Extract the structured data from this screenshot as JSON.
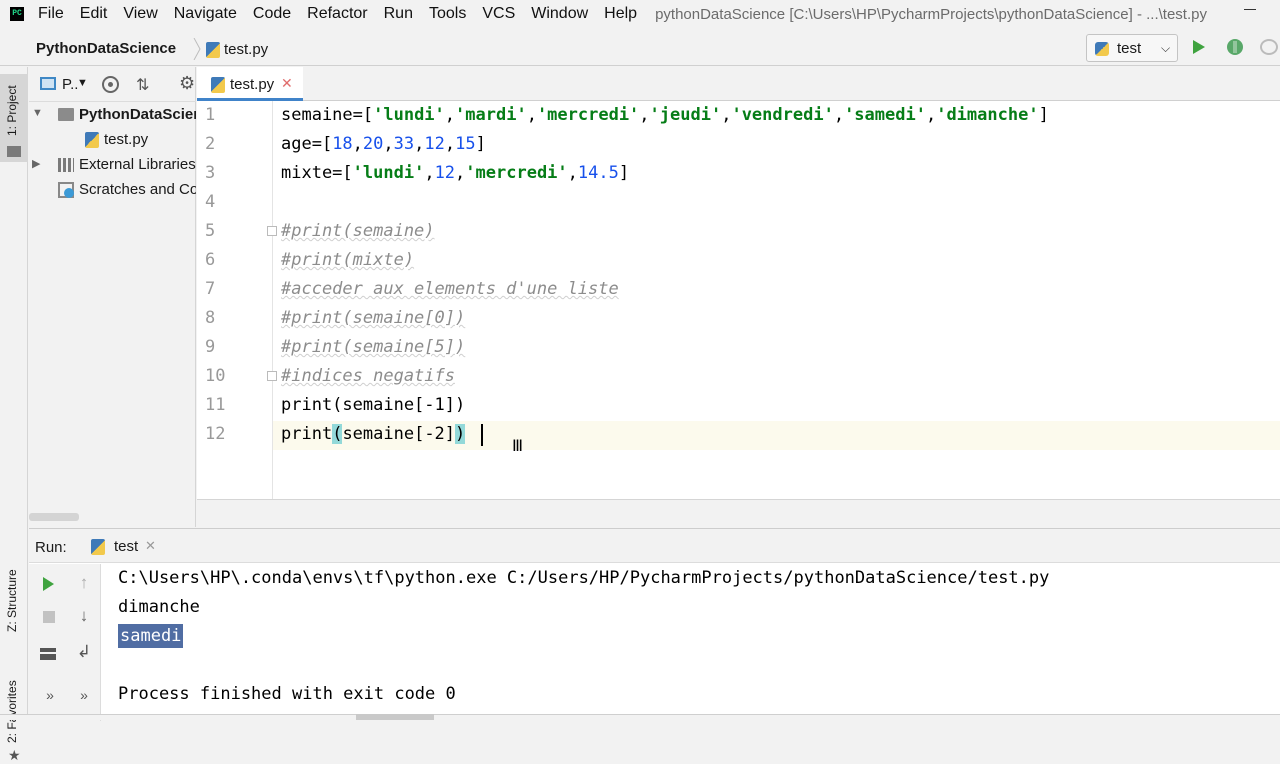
{
  "app": {
    "logo_text": "PC"
  },
  "menu": {
    "items": [
      "File",
      "Edit",
      "View",
      "Navigate",
      "Code",
      "Refactor",
      "Run",
      "Tools",
      "VCS",
      "Window",
      "Help"
    ],
    "window_title": "pythonDataScience [C:\\Users\\HP\\PycharmProjects\\pythonDataScience] - ...\\test.py"
  },
  "navbar": {
    "project": "PythonDataScience",
    "file": "test.py",
    "run_config": "test"
  },
  "left_stripe": {
    "project_label": "1: Project",
    "structure_label": "Z: Structure",
    "favorites_label": "2: Favorites"
  },
  "project_panel": {
    "view_label": "P..",
    "tree": {
      "root": "PythonDataScience",
      "file": "test.py",
      "external": "External Libraries",
      "scratches": "Scratches and Consoles"
    }
  },
  "editor": {
    "tab_label": "test.py",
    "line_numbers": [
      "1",
      "2",
      "3",
      "4",
      "5",
      "6",
      "7",
      "8",
      "9",
      "10",
      "11",
      "12"
    ],
    "lines": [
      {
        "t1": "semaine=[",
        "s": [
          "'lundi'",
          "'mardi'",
          "'mercredi'",
          "'jeudi'",
          "'vendredi'",
          "'samedi'",
          "'dimanche'"
        ],
        "t2": "]"
      },
      {
        "t1": "age=[",
        "n": [
          "18",
          "20",
          "33",
          "12",
          "15"
        ],
        "t2": "]"
      },
      {
        "t1": "mixte=[",
        "a": "'lundi'",
        "b": "12",
        "c": "'mercredi'",
        "d": "14.5",
        "t2": "]"
      },
      {
        "text": ""
      },
      {
        "comment": "#print(semaine)"
      },
      {
        "comment": "#print(mixte)"
      },
      {
        "comment": "#acceder aux elements d'une liste"
      },
      {
        "comment": "#print(semaine[0])"
      },
      {
        "comment": "#print(semaine[5])"
      },
      {
        "comment": "#indices negatifs"
      },
      {
        "code": "print(semaine[-1])"
      },
      {
        "p1": "print",
        "p2": "(",
        "p3": "semaine[-2]",
        "p4": ")"
      }
    ]
  },
  "run_panel": {
    "title": "Run:",
    "tab_label": "test",
    "console": {
      "command": "C:\\Users\\HP\\.conda\\envs\\tf\\python.exe C:/Users/HP/PycharmProjects/pythonDataScience/test.py",
      "out1": "dimanche",
      "out2": "samedi",
      "exit": "Process finished with exit code 0"
    }
  }
}
